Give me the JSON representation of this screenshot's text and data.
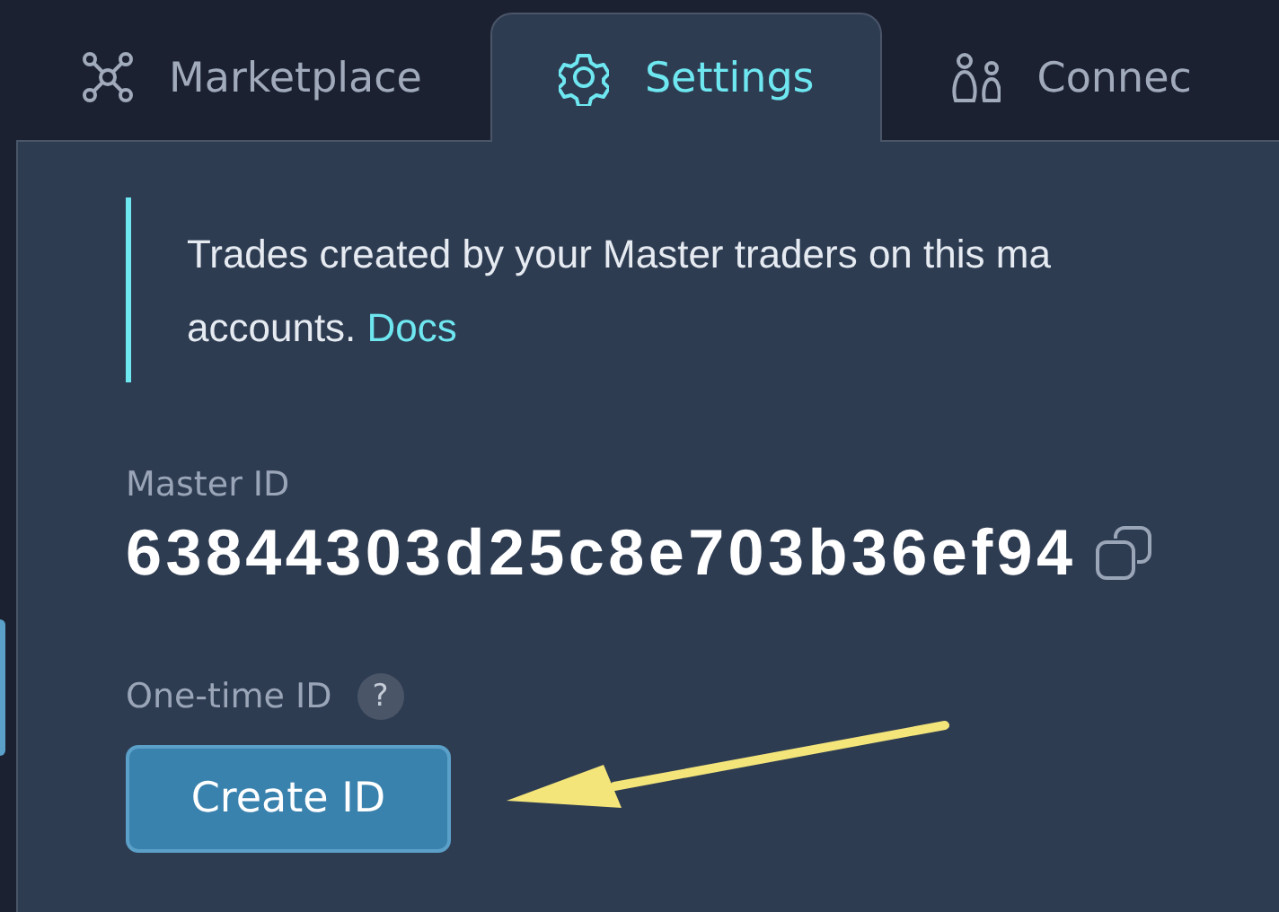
{
  "tabs": [
    {
      "label": "Marketplace",
      "selected": false
    },
    {
      "label": "Settings",
      "selected": true
    },
    {
      "label": "Connec",
      "selected": false
    }
  ],
  "callout": {
    "text": "Trades created by your Master traders on this ma",
    "text_continued": "accounts.",
    "link": "Docs"
  },
  "master_id": {
    "label": "Master ID",
    "value": "63844303d25c8e703b36ef94"
  },
  "one_time_id": {
    "label": "One-time ID",
    "help": "?",
    "button": "Create ID"
  }
}
